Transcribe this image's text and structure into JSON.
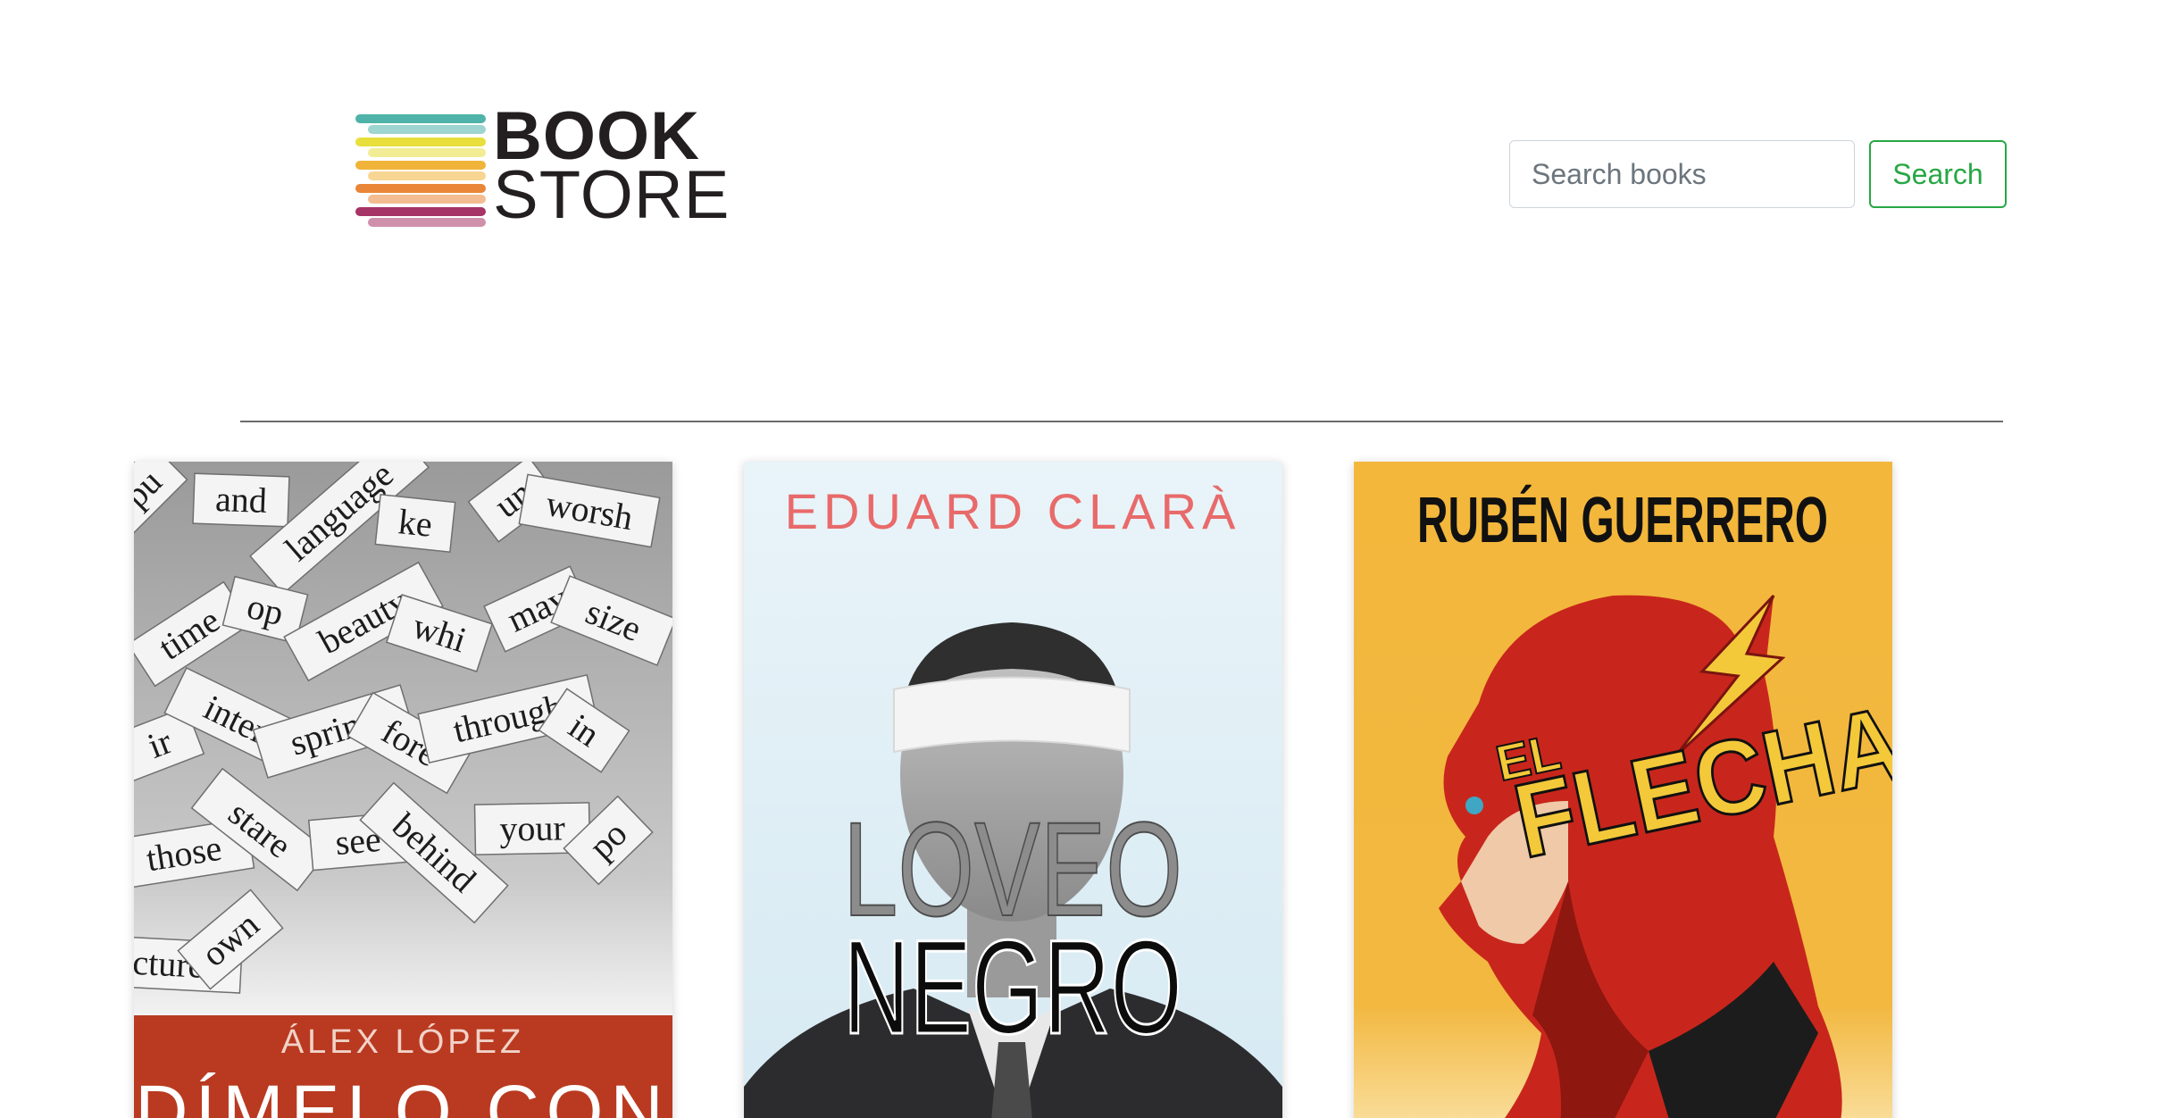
{
  "header": {
    "logo_line1": "BOOK",
    "logo_line2": "STORE",
    "search_placeholder": "Search books",
    "search_button_label": "Search"
  },
  "books": [
    {
      "author": "ÁLEX LÓPEZ",
      "title_partial": "DÍMELO CON",
      "cover_words": [
        "pu",
        "and",
        "language",
        "ke",
        "un",
        "worsh",
        "time",
        "op",
        "beauty",
        "whi",
        "may",
        "size",
        "ir",
        "inter",
        "spring",
        "fore",
        "through",
        "in",
        "those",
        "stare",
        "see",
        "behind",
        "your",
        "po",
        "picture",
        "own"
      ]
    },
    {
      "author": "EDUARD CLARÀ",
      "title_line1": "LOVEO",
      "title_line2": "NEGRO"
    },
    {
      "author": "RUBÉN GUERRERO",
      "title_small": "EL",
      "title_big": "FLECHA"
    }
  ],
  "colors": {
    "success": "#28a745",
    "input_border": "#ced4da",
    "divider": "#6c6c6c",
    "cover1_band": "#b93a20",
    "cover2_author": "#e86a6a",
    "cover3_bg": "#f3b73c",
    "cover3_hero": "#c8261c"
  },
  "logo_stripe_colors": [
    "#4fb3a9",
    "#e8df3c",
    "#f0b43a",
    "#e98637",
    "#a73467"
  ]
}
